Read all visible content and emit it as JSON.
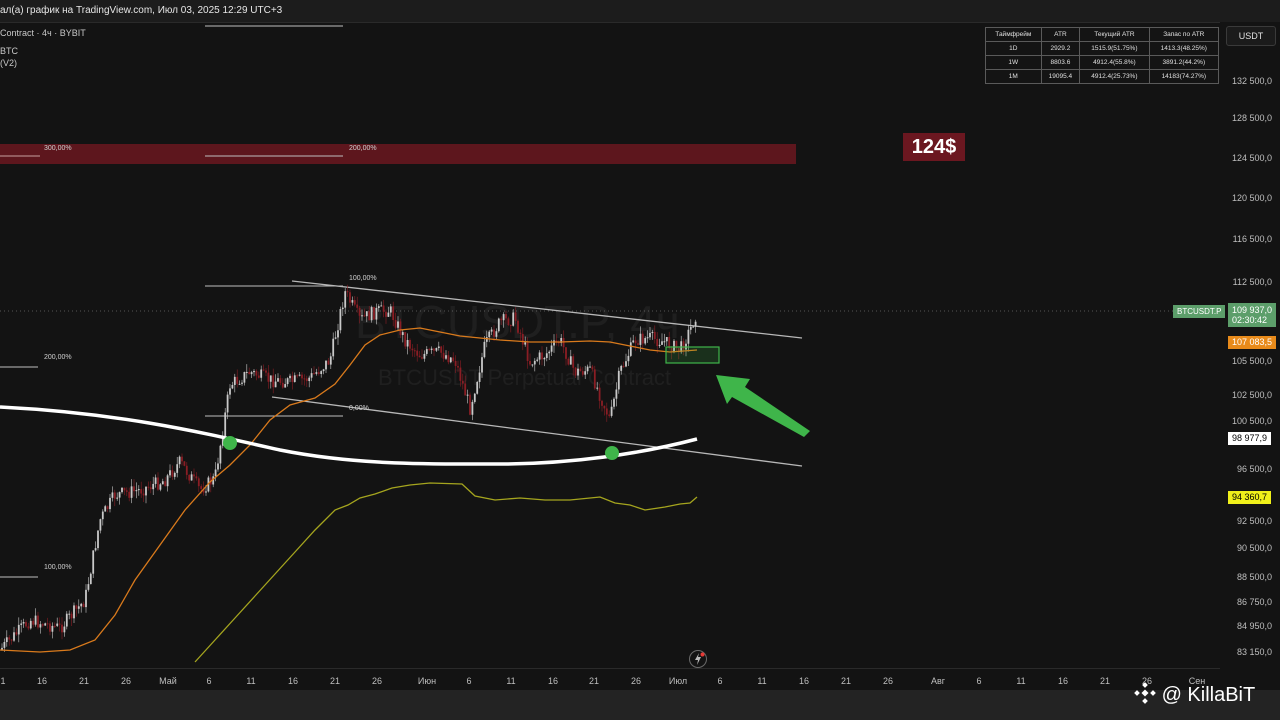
{
  "header": {
    "title": "ал(а) график на TradingView.com, Июл 03, 2025 12:29 UTC+3"
  },
  "legend": {
    "line1": "Contract · 4ч · BYBIT",
    "line2": "BTC",
    "line3": "(V2)"
  },
  "currency_button": "USDT",
  "y_axis_ticks": [
    "132 500,0",
    "128 500,0",
    "124 500,0",
    "120 500,0",
    "116 500,0",
    "112 500,0",
    "105 500,0",
    "102 500,0",
    "100 500,0",
    "96 500,0",
    "92 500,0",
    "90 500,0",
    "88 500,0",
    "86 750,0",
    "84 950,0",
    "83 150,0"
  ],
  "x_axis_ticks": [
    "1",
    "16",
    "21",
    "26",
    "Май",
    "6",
    "11",
    "16",
    "21",
    "26",
    "Июн",
    "6",
    "11",
    "16",
    "21",
    "26",
    "Июл",
    "6",
    "11",
    "16",
    "21",
    "26",
    "Авг",
    "6",
    "11",
    "16",
    "21",
    "26",
    "Сен"
  ],
  "price_labels": {
    "symbol": "BTCUSDT.P",
    "last_price": "109 937,0",
    "countdown": "02:30:42",
    "orange_ma": "107 083,5",
    "white_curve": "98 977,9",
    "yellow_line": "94 360,7"
  },
  "atr_table": {
    "headers": [
      "Таймфрейм",
      "ATR",
      "Текущий ATR",
      "Запас по ATR"
    ],
    "rows": [
      [
        "1D",
        "2929.2",
        "1515.9(51.75%)",
        "1413.3(48.25%)"
      ],
      [
        "1W",
        "8803.6",
        "4912.4(55.8%)",
        "3891.2(44.2%)"
      ],
      [
        "1M",
        "19095.4",
        "4912.4(25.73%)",
        "14183(74.27%)"
      ]
    ]
  },
  "fib_labels": {
    "f300": "300,00%",
    "f200_top": "200,00%",
    "f100_mid": "100,00%",
    "f0": "0,00%",
    "f200_left": "200,00%",
    "f100_left": "100,00%"
  },
  "target_badge": "124$",
  "watermark": {
    "symbol": "BTCUSDT.P, 4ч",
    "name": "BTCUSDT Perpetual Contract"
  },
  "branding": {
    "name": "@ KillaBiT"
  },
  "colors": {
    "background": "#131313",
    "bull_candle": "#c9c9c9",
    "bear_candle": "#8a1d24",
    "orange_ma": "#d97a1c",
    "yellow_line": "#a5a51e",
    "white_curve": "#ffffff",
    "green_accent": "#3fb54a",
    "target_zone": "#6b1720",
    "price_label_green": "#5c9e6a"
  }
}
